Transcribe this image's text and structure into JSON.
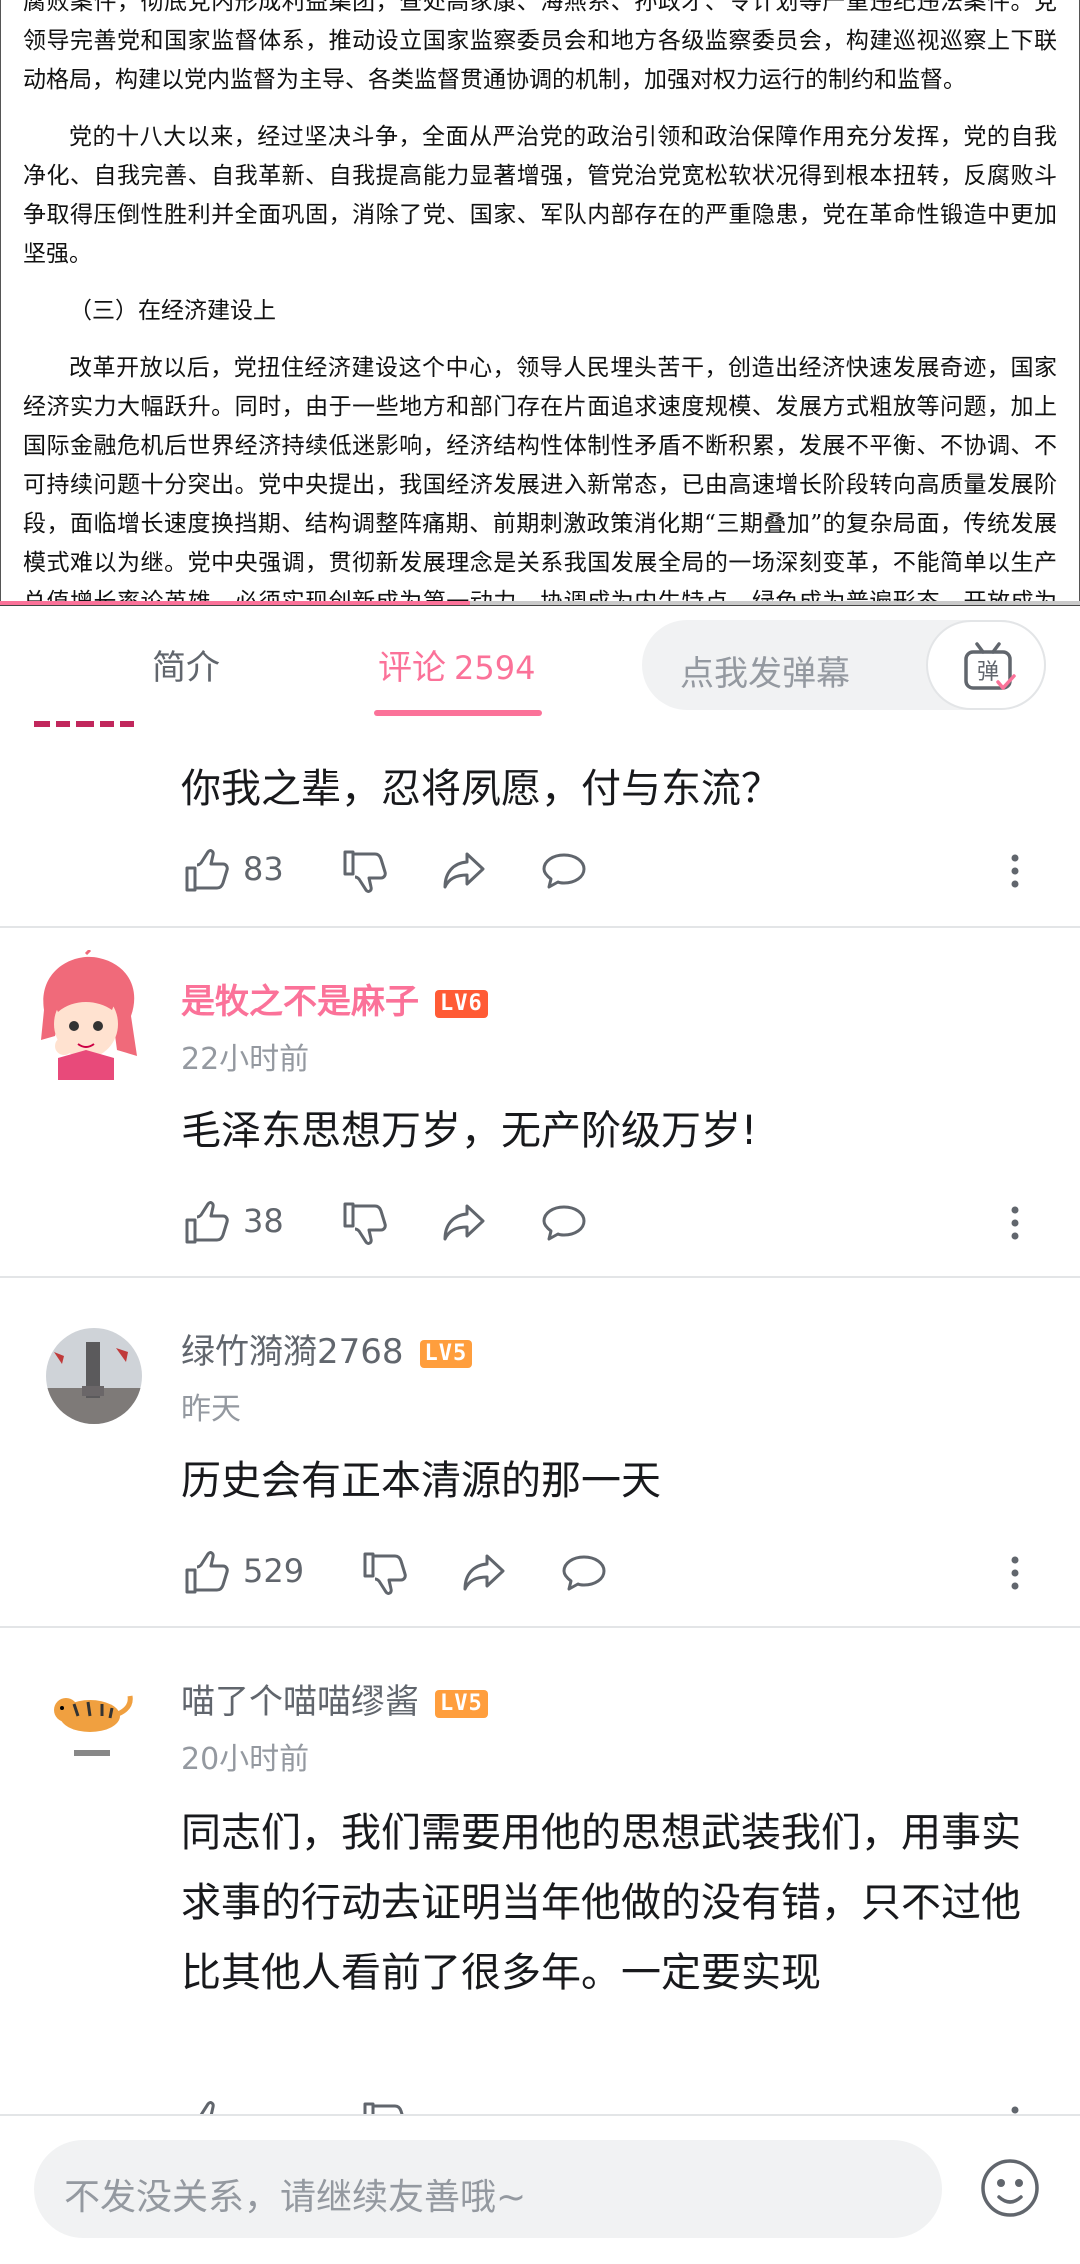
{
  "document": {
    "paragraphs": [
      "腐败案件，彻底党内形成利益集团，查处高家康、海燕系、孙政才、令计划等严重违纪违法案件。党领导完善党和国家监督体系，推动设立国家监察委员会和地方各级监察委员会，构建巡视巡察上下联动格局，构建以党内监督为主导、各类监督贯通协调的机制，加强对权力运行的制约和监督。",
      "党的十八大以来，经过坚决斗争，全面从严治党的政治引领和政治保障作用充分发挥，党的自我净化、自我完善、自我革新、自我提高能力显著增强，管党治党宽松软状况得到根本扭转，反腐败斗争取得压倒性胜利并全面巩固，消除了党、国家、军队内部存在的严重隐患，党在革命性锻造中更加坚强。",
      "（三）在经济建设上",
      "改革开放以后，党扭住经济建设这个中心，领导人民埋头苦干，创造出经济快速发展奇迹，国家经济实力大幅跃升。同时，由于一些地方和部门存在片面追求速度规模、发展方式粗放等问题，加上国际金融危机后世界经济持续低迷影响，经济结构性体制性矛盾不断积累，发展不平衡、不协调、不可持续问题十分突出。党中央提出，我国经济发展进入新常态，已由高速增长阶段转向高质量发展阶段，面临增长速度换挡期、结构调整阵痛期、前期刺激政策消化期“三期叠加”的复杂局面，传统发展模式难以为继。党中央强调，贯彻新发展理念是关系我国发展全局的一场深刻变革，不能简单以生产总值增长率论英雄，必须实现创新成为第一动力、协调成为内生特点、绿色成为普遍形态、开放成为必由之路、共享成为根本目的的高质量发展，推动经济发展质量变革、效率变革、动力变革。"
    ],
    "progress_fraction": 0.435
  },
  "tabs": {
    "intro": "简介",
    "comments": "评论",
    "comment_count": "2594",
    "danmaku_placeholder": "点我发弹幕",
    "danmaku_icon_char": "弹"
  },
  "comments": [
    {
      "text": "你我之辈，忍将夙愿，付与东流？",
      "likes": "83"
    },
    {
      "username": "是牧之不是麻子",
      "level": "LV6",
      "time": "22小时前",
      "text": "毛泽东思想万岁，无产阶级万岁!",
      "likes": "38"
    },
    {
      "username": "绿竹漪漪2768",
      "level": "LV5",
      "time": "昨天",
      "text": "历史会有正本清源的那一天",
      "likes": "529"
    },
    {
      "username": "喵了个喵喵缪酱",
      "level": "LV5",
      "time": "20小时前",
      "text": "同志们，我们需要用他的思想武装我们，用事实求事的行动去证明当年他做的没有错，只不过他比其他人看前了很多年。一定要实现"
    }
  ],
  "bottom": {
    "input_placeholder": "不发没关系，请继续友善哦~"
  },
  "colors": {
    "accent": "#fb7299",
    "lv6": "#ff5b35",
    "lv5": "#ff9e3d",
    "muted": "#9499a0"
  },
  "icons": [
    "like-icon",
    "dislike-icon",
    "share-icon",
    "reply-icon",
    "more-icon",
    "danmaku-icon",
    "emoji-icon"
  ]
}
